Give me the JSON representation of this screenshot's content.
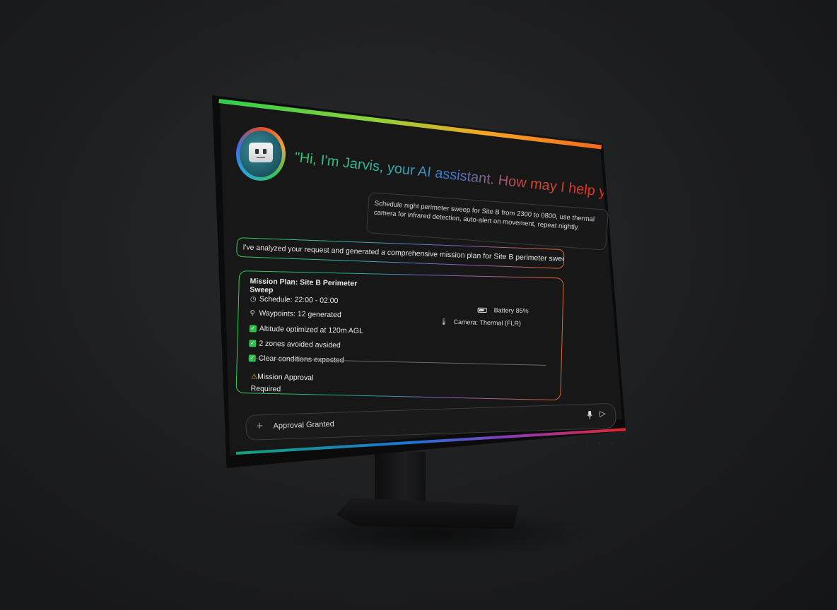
{
  "assistant": {
    "greeting": "\"Hi, I'm Jarvis, your AI assistant. How may I help you?\""
  },
  "chat": {
    "user_message": "Schedule night perimeter sweep for Site B from 2300 to 0800, use thermal camera for infrared detection, auto-alert on movement, repeat nightly.",
    "ai_response": "I've analyzed your request and generated a comprehensive mission plan for Site B perimeter sweep."
  },
  "mission": {
    "title": "Mission Plan: Site B Perimeter Sweep",
    "schedule": "Schedule: 22:00 - 02:00",
    "waypoints": "Waypoints: 12 generated",
    "checks": [
      "Altitude optimized at 120m AGL",
      "2 zones avoided avsided",
      "Clear conditions expected"
    ],
    "battery": "Battery 85%",
    "camera": "Camera: Thermal (FLR)",
    "approval_line1": "Mission Approval",
    "approval_line2": "Required"
  },
  "input": {
    "value": "Approval Granted"
  },
  "icons": {
    "clock": "clock-icon",
    "pin": "map-pin-icon",
    "check": "checkbox-checked-icon",
    "battery": "battery-icon",
    "thermometer": "thermometer-icon",
    "warning": "warning-icon",
    "plus": "plus-icon",
    "mic": "microphone-icon",
    "send": "send-icon"
  },
  "colors": {
    "accent_green": "#2ecc4a",
    "accent_orange": "#f26a1b",
    "accent_red": "#e3272b",
    "accent_blue": "#1c74d8",
    "check_green": "#2fbf4b",
    "warning_yellow": "#f0b429"
  }
}
